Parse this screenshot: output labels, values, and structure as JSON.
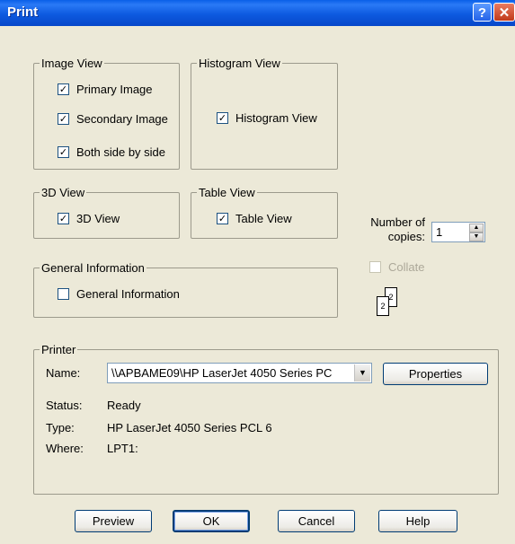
{
  "window": {
    "title": "Print",
    "help_glyph": "?",
    "close_glyph": "✕"
  },
  "image_view": {
    "legend": "Image View",
    "items": [
      {
        "label": "Primary Image",
        "checked": true
      },
      {
        "label": "Secondary Image",
        "checked": true
      },
      {
        "label": "Both side by side",
        "checked": true
      }
    ]
  },
  "histogram_view": {
    "legend": "Histogram View",
    "item": {
      "label": "Histogram View",
      "checked": true
    }
  },
  "view_3d": {
    "legend": "3D View",
    "item": {
      "label": "3D View",
      "checked": true
    }
  },
  "table_view": {
    "legend": "Table View",
    "item": {
      "label": "Table View",
      "checked": true
    }
  },
  "general_info": {
    "legend": "General Information",
    "item": {
      "label": "General Information",
      "checked": false
    }
  },
  "copies": {
    "label_line1": "Number of",
    "label_line2": "copies:",
    "value": "1",
    "collate_label": "Collate",
    "collate_checked": false,
    "page_back": "2",
    "page_front": "2"
  },
  "printer": {
    "legend": "Printer",
    "name_label": "Name:",
    "name_value": "\\\\APBAME09\\HP LaserJet 4050 Series PC",
    "properties_label": "Properties",
    "status_label": "Status:",
    "status_value": "Ready",
    "type_label": "Type:",
    "type_value": "HP LaserJet 4050 Series PCL 6",
    "where_label": "Where:",
    "where_value": "LPT1:"
  },
  "buttons": {
    "preview": "Preview",
    "ok": "OK",
    "cancel": "Cancel",
    "help": "Help"
  },
  "colors": {
    "dialog_bg": "#ece9d8",
    "title_bar": "#0a5fe8",
    "close_button": "#c13a1a"
  }
}
